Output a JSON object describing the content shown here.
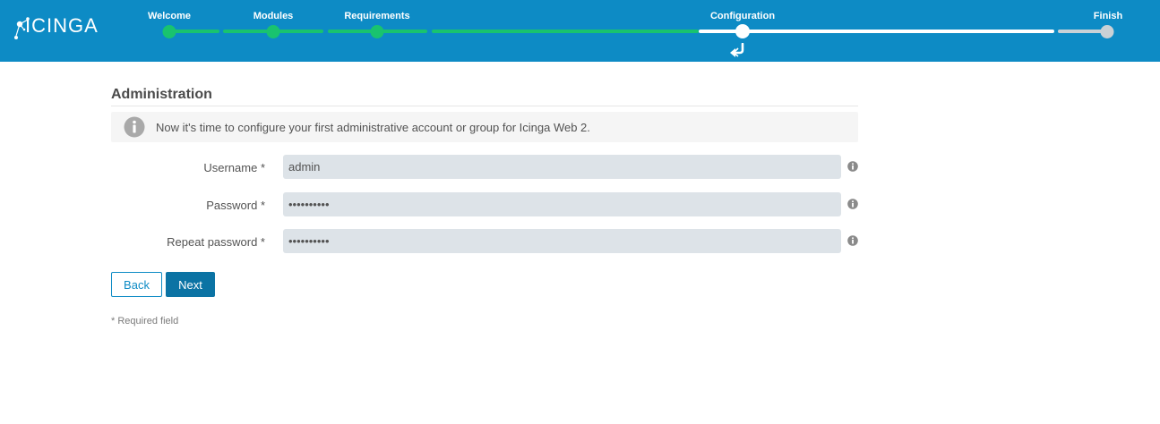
{
  "header": {
    "logo_text": "ICINGA",
    "steps": [
      "Welcome",
      "Modules",
      "Requirements",
      "Configuration",
      "Finish"
    ],
    "current_step": "Configuration"
  },
  "main": {
    "title": "Administration",
    "info_text": "Now it's time to configure your first administrative account or group for Icinga Web 2.",
    "fields": {
      "username": {
        "label": "Username *",
        "value": "admin"
      },
      "password": {
        "label": "Password *",
        "value": "••••••••••"
      },
      "repeat_password": {
        "label": "Repeat password *",
        "value": "••••••••••"
      }
    },
    "buttons": {
      "back": "Back",
      "next": "Next"
    },
    "required_note": "* Required field"
  },
  "colors": {
    "header_bg": "#0d8bc5",
    "progress_done": "#19c36f",
    "progress_current": "#ffffff",
    "progress_todo": "#c9d1d6",
    "primary_button": "#0b73a4",
    "input_bg": "#dde3e8"
  },
  "icons": [
    "icinga-logo-icon",
    "return-arrow-icon",
    "info-icon",
    "help-icon"
  ]
}
